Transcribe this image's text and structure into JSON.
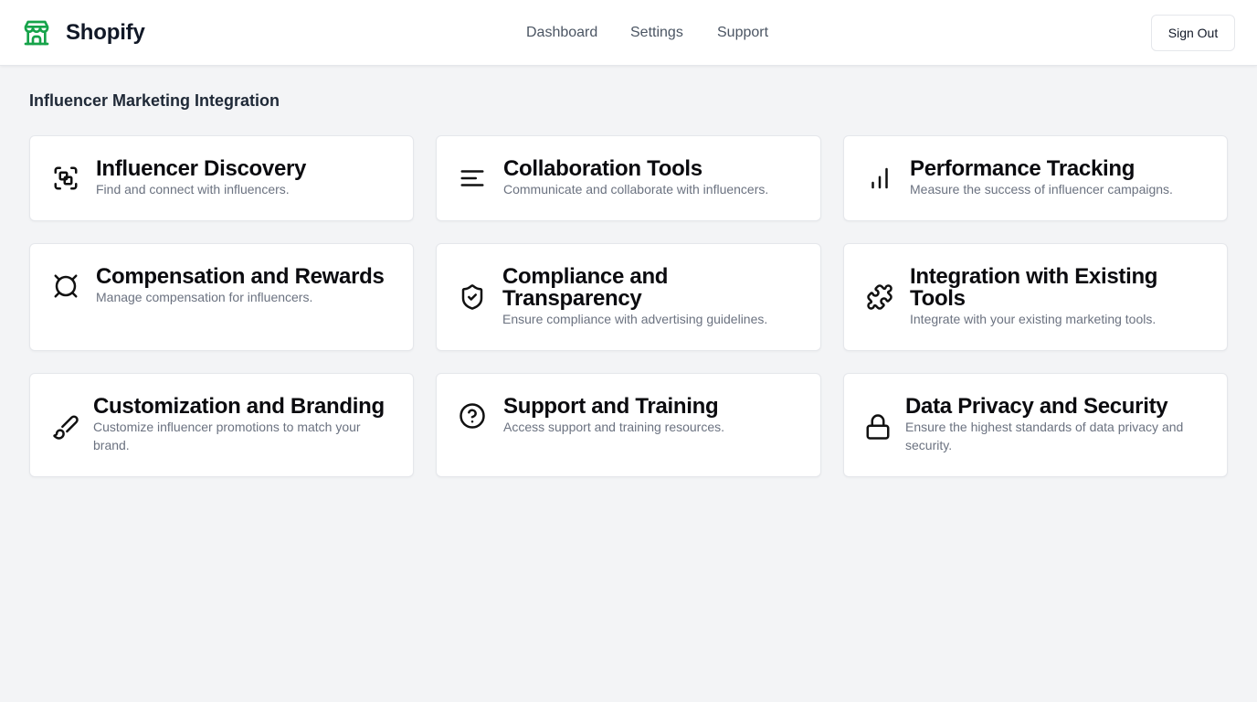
{
  "header": {
    "brand": "Shopify",
    "logo_icon": "store-icon",
    "brand_color": "#16a34a",
    "nav": [
      "Dashboard",
      "Settings",
      "Support"
    ],
    "signout_label": "Sign Out"
  },
  "page": {
    "title": "Influencer Marketing Integration"
  },
  "features": [
    {
      "title": "Influencer Discovery",
      "description": "Find and connect with influencers.",
      "icon": "scan-link-icon"
    },
    {
      "title": "Collaboration Tools",
      "description": "Communicate and collaborate with influencers.",
      "icon": "text-lines-icon"
    },
    {
      "title": "Performance Tracking",
      "description": "Measure the success of influencer campaigns.",
      "icon": "bar-chart-icon"
    },
    {
      "title": "Compensation and Rewards",
      "description": "Manage compensation for influencers.",
      "icon": "currency-icon"
    },
    {
      "title": "Compliance and Transparency",
      "description": "Ensure compliance with advertising guidelines.",
      "icon": "shield-check-icon"
    },
    {
      "title": "Integration with Existing Tools",
      "description": "Integrate with your existing marketing tools.",
      "icon": "puzzle-icon"
    },
    {
      "title": "Customization and Branding",
      "description": "Customize influencer promotions to match your brand.",
      "icon": "brush-icon"
    },
    {
      "title": "Support and Training",
      "description": "Access support and training resources.",
      "icon": "help-circle-icon"
    },
    {
      "title": "Data Privacy and Security",
      "description": "Ensure the highest standards of data privacy and security.",
      "icon": "lock-icon"
    }
  ]
}
